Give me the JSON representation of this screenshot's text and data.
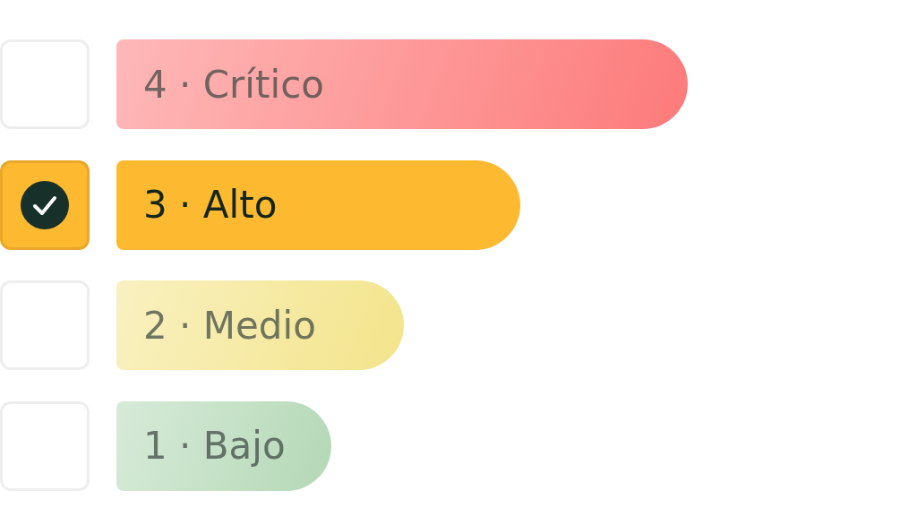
{
  "levels": [
    {
      "label": "4 · Crítico",
      "checked": false,
      "color": "#fd7a7a",
      "kind": "muted"
    },
    {
      "label": "3 · Alto",
      "checked": true,
      "color": "#fdb92f",
      "kind": "strong"
    },
    {
      "label": "2 · Medio",
      "checked": false,
      "color": "#f3e48a",
      "kind": "muted"
    },
    {
      "label": "1 · Bajo",
      "checked": false,
      "color": "#b4d8b6",
      "kind": "muted"
    }
  ]
}
